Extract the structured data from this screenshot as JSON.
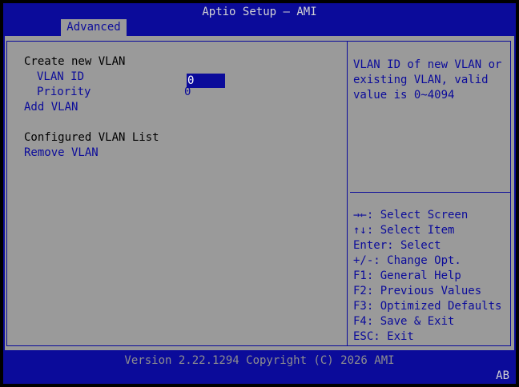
{
  "window": {
    "title": "Aptio Setup – AMI"
  },
  "tabs": [
    {
      "label": "Advanced"
    }
  ],
  "main": {
    "create_heading": "Create new VLAN",
    "vlan_id_label": "VLAN ID",
    "vlan_id_value": "0",
    "priority_label": "Priority",
    "priority_value": "0",
    "add_vlan": "Add VLAN",
    "configured_heading": "Configured VLAN List",
    "remove_vlan": "Remove VLAN"
  },
  "help": {
    "lines": [
      "VLAN ID of new VLAN or",
      "existing VLAN, valid",
      "value is 0~4094"
    ]
  },
  "keys": [
    "→←: Select Screen",
    "↑↓: Select Item",
    "Enter: Select",
    "+/-: Change Opt.",
    "F1: General Help",
    "F2: Previous Values",
    "F3: Optimized Defaults",
    "F4: Save & Exit",
    "ESC: Exit"
  ],
  "footer": {
    "version": "Version 2.22.1294 Copyright (C) 2026 AMI",
    "code": "AB"
  },
  "colors": {
    "background": "#9a9a9a",
    "accent": "#0b0b9a"
  }
}
